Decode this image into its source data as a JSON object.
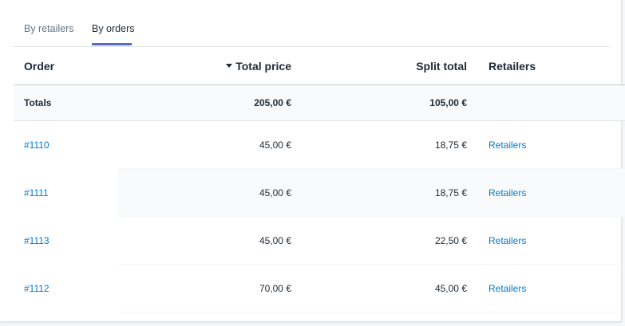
{
  "tabs": [
    {
      "label": "By retailers",
      "active": false
    },
    {
      "label": "By orders",
      "active": true
    }
  ],
  "table": {
    "headers": {
      "order": "Order",
      "total_price": "Total price",
      "split_total": "Split total",
      "retailers": "Retailers"
    },
    "sort": {
      "column": "total_price",
      "direction": "descending",
      "icon": "sort-descending-icon"
    },
    "totals": {
      "label": "Totals",
      "total_price": "205,00 €",
      "split_total": "105,00 €"
    },
    "rows": [
      {
        "order": "#1110",
        "total_price": "45,00 €",
        "split_total": "18,75 €",
        "retailers": "Retailers"
      },
      {
        "order": "#1111",
        "total_price": "45,00 €",
        "split_total": "18,75 €",
        "retailers": "Retailers"
      },
      {
        "order": "#1113",
        "total_price": "45,00 €",
        "split_total": "22,50 €",
        "retailers": "Retailers"
      },
      {
        "order": "#1112",
        "total_price": "70,00 €",
        "split_total": "45,00 €",
        "retailers": "Retailers"
      }
    ]
  },
  "colors": {
    "accent": "#5c6ac4",
    "link": "#007ace",
    "text": "#212b36",
    "muted": "#637381",
    "row_alt": "#f9fafb"
  }
}
